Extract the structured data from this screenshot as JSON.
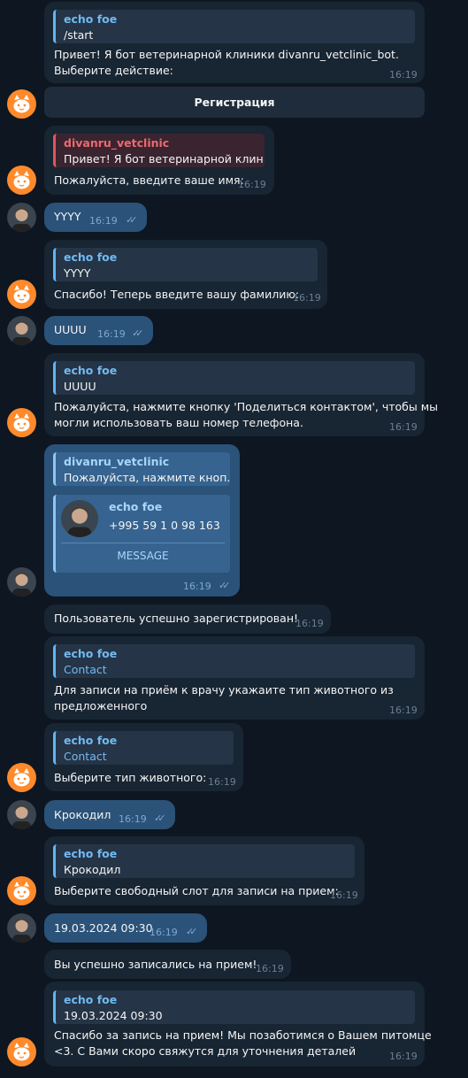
{
  "messages": {
    "m1": {
      "quote_name": "echo foe",
      "quote_text": "/start",
      "line1": "Привет! Я бот ветеринарной клиники divanru_vetclinic_bot.",
      "line2": "Выберите действие:",
      "time": "16:19"
    },
    "reg_button": "Регистрация",
    "m2": {
      "quote_name": "divanru_vetclinic",
      "quote_text": "Привет! Я бот ветеринарной клин...",
      "line1": "Пожалуйста, введите ваше имя:",
      "time": "16:19"
    },
    "m3": {
      "text": "YYYY",
      "time": "16:19"
    },
    "m4": {
      "quote_name": "echo foe",
      "quote_text": "YYYY",
      "line1": "Спасибо! Теперь введите вашу фамилию:",
      "time": "16:19"
    },
    "m5": {
      "text": "UUUU",
      "time": "16:19"
    },
    "m6": {
      "quote_name": "echo foe",
      "quote_text": "UUUU",
      "line1": "Пожалуйста, нажмите кнопку 'Поделиться контактом', чтобы мы",
      "line2": "могли использовать ваш номер телефона.",
      "time": "16:19"
    },
    "m7": {
      "quote_name": "divanru_vetclinic",
      "quote_text": "Пожалуйста, нажмите кноп...",
      "contact_name": "echo foe",
      "contact_phone": "+995  59 1 0 98 163",
      "contact_button": "MESSAGE",
      "time": "16:19"
    },
    "m8": {
      "line1": "Пользователь успешно зарегистрирован!",
      "time": "16:19"
    },
    "m9": {
      "quote_name": "echo foe",
      "quote_text": "Contact",
      "line1": "Для записи на приём к врачу укажаите тип животного из",
      "line2": "предложенного",
      "time": "16:19"
    },
    "m10": {
      "quote_name": "echo foe",
      "quote_text": "Contact",
      "line1": "Выберите тип животного:",
      "time": "16:19"
    },
    "m11": {
      "text": "Крокодил",
      "time": "16:19"
    },
    "m12": {
      "quote_name": "echo foe",
      "quote_text": "Крокодил",
      "line1": "Выберите свободный слот для записи на прием:",
      "time": "16:19"
    },
    "m13": {
      "text": "19.03.2024 09:30",
      "time": "16:19"
    },
    "m14": {
      "line1": "Вы успешно записались на прием!",
      "time": "16:19"
    },
    "m15": {
      "quote_name": "echo foe",
      "quote_text": "19.03.2024 09:30",
      "line1": "Спасибо за запись на прием! Мы позаботимся о Вашем питомце",
      "line2": "<3. С Вами скоро свяжутся для уточнения деталей",
      "time": "16:19"
    }
  },
  "read_checks": "✓✓"
}
